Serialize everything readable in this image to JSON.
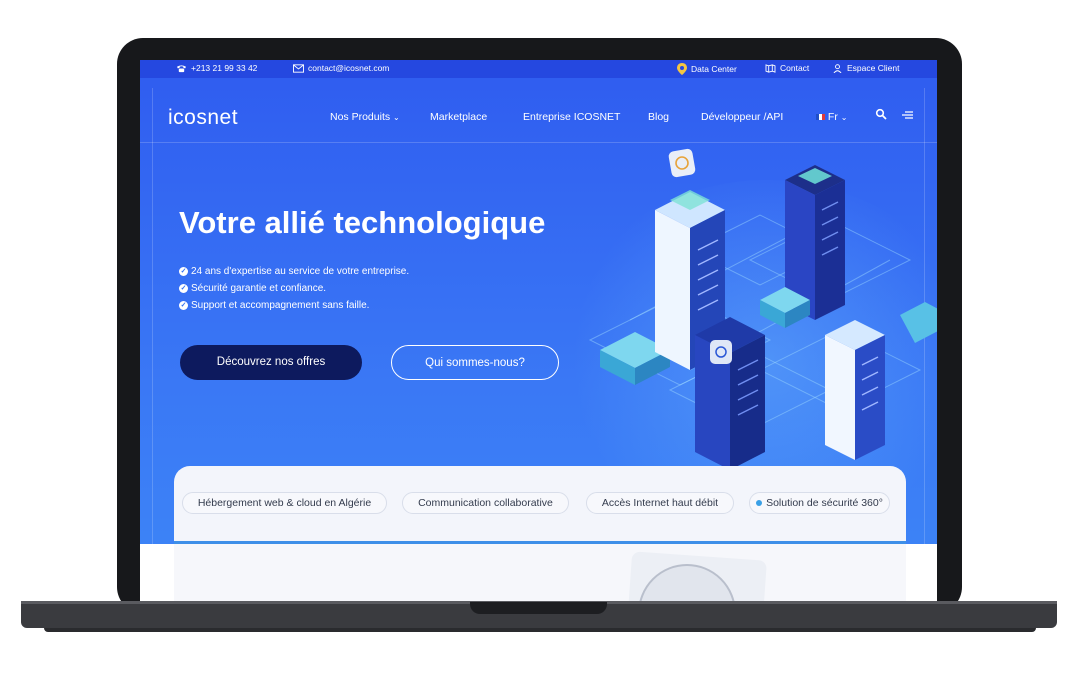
{
  "topbar": {
    "phone": "+213 21 99 33 42",
    "email": "contact@icosnet.com",
    "data_center": "Data Center",
    "contact": "Contact",
    "espace_client": "Espace Client"
  },
  "nav": {
    "logo": "icosnet",
    "items": [
      "Nos Produits",
      "Marketplace",
      "Entreprise ICOSNET",
      "Blog",
      "Développeur /API"
    ],
    "language": "Fr"
  },
  "hero": {
    "title": "Votre allié technologique",
    "bullets": [
      "24 ans d'expertise au service de votre entreprise.",
      "Sécurité garantie et confiance.",
      "Support et accompagnement sans faille."
    ],
    "primary_button": "Découvrez nos offres",
    "secondary_button": "Qui sommes-nous?"
  },
  "tabs": [
    "Hébergement web & cloud en Algérie",
    "Communication collaborative",
    "Accès Internet haut débit",
    "Solution de sécurité 360°"
  ],
  "active_tab_index": 3,
  "colors": {
    "brand_blue": "#2f6df0",
    "topbar_blue": "#2548e0",
    "primary_button": "#0d1a5e",
    "active_tab_dot": "#3aa0e6"
  },
  "icons": {
    "phone": "phone-icon",
    "email": "mail-icon",
    "data_center": "location-pin-icon",
    "contact": "map-icon",
    "espace_client": "user-icon",
    "search": "search-icon",
    "menu": "menu-icon",
    "language_flag": "france-flag-icon"
  }
}
